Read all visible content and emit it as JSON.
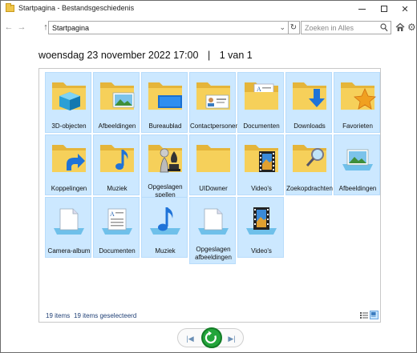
{
  "window": {
    "title": "Startpagina - Bestandsgeschiedenis"
  },
  "nav": {
    "address": "Startpagina",
    "search_placeholder": "Zoeken in Alles"
  },
  "heading": {
    "date": "woensdag 23 november 2022 17:00",
    "separator": "|",
    "position": "1 van 1"
  },
  "items": [
    {
      "label": "3D-objecten",
      "icon": "folder-3d-icon"
    },
    {
      "label": "Afbeeldingen",
      "icon": "folder-pictures-icon"
    },
    {
      "label": "Bureaublad",
      "icon": "folder-desktop-icon"
    },
    {
      "label": "Contactpersonen",
      "icon": "folder-contacts-icon"
    },
    {
      "label": "Documenten",
      "icon": "folder-documents-icon"
    },
    {
      "label": "Downloads",
      "icon": "folder-downloads-icon"
    },
    {
      "label": "Favorieten",
      "icon": "folder-favorites-icon"
    },
    {
      "label": "Koppelingen",
      "icon": "folder-links-icon"
    },
    {
      "label": "Muziek",
      "icon": "folder-music-icon"
    },
    {
      "label": "Opgeslagen spellen",
      "icon": "folder-saved-games-icon"
    },
    {
      "label": "UIDowner",
      "icon": "folder-user-icon"
    },
    {
      "label": "Video's",
      "icon": "folder-videos-icon"
    },
    {
      "label": "Zoekopdrachten",
      "icon": "folder-searches-icon"
    },
    {
      "label": "Afbeeldingen",
      "icon": "library-pictures-icon"
    },
    {
      "label": "Camera-album",
      "icon": "library-camera-roll-icon"
    },
    {
      "label": "Documenten",
      "icon": "library-documents-icon"
    },
    {
      "label": "Muziek",
      "icon": "library-music-icon"
    },
    {
      "label": "Opgeslagen afbeeldingen",
      "icon": "library-saved-pictures-icon"
    },
    {
      "label": "Video's",
      "icon": "library-videos-icon"
    }
  ],
  "status": {
    "count": "19 items",
    "selected": "19 items geselecteerd"
  },
  "colors": {
    "selection": "#cce8ff",
    "folder": "#f6d05a",
    "accent": "#0078d7",
    "restore": "#23a53b"
  }
}
